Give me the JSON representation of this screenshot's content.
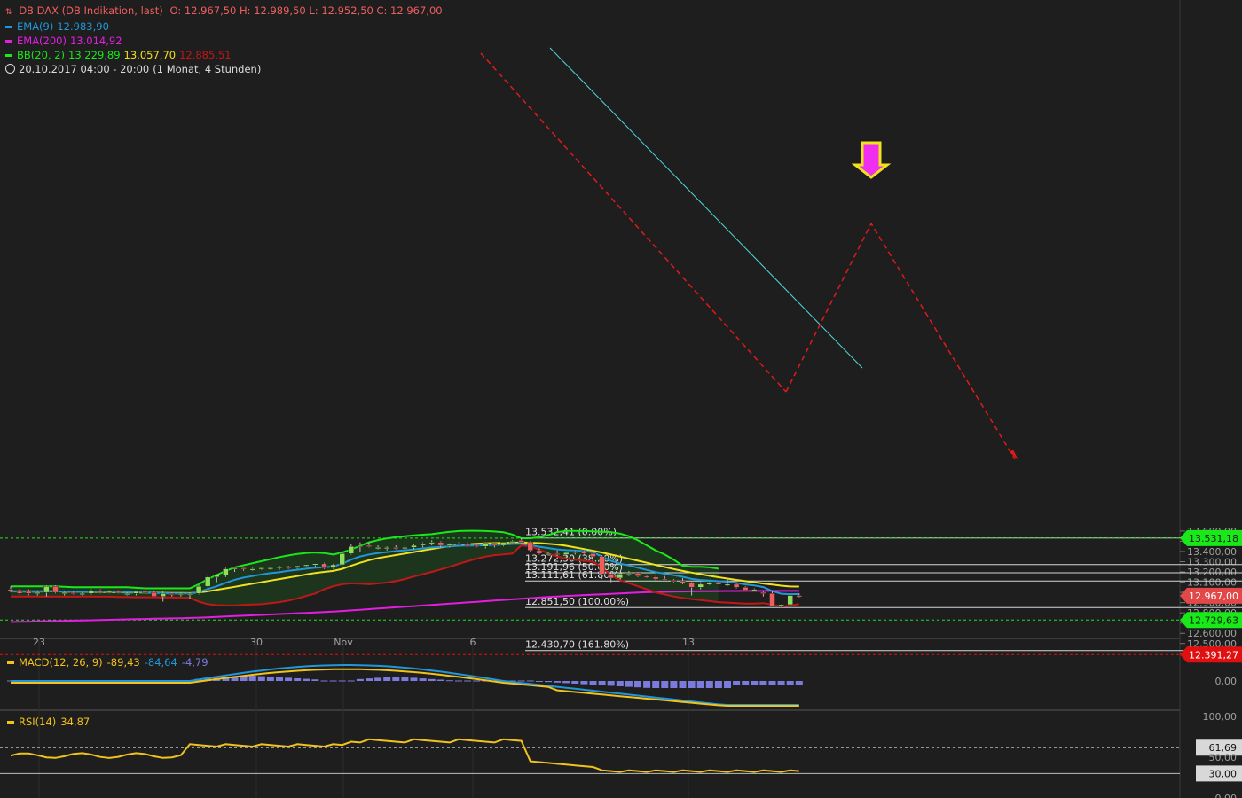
{
  "header": {
    "title": "DB DAX (DB Indikation, last)",
    "ohlc": "O: 12.967,50   H: 12.989,50   L: 12.952,50   C: 12.967,00",
    "ema9_label": "EMA(9)",
    "ema9_value": "12.983,90",
    "ema200_label": "EMA(200)",
    "ema200_value": "13.014,92",
    "bb_label": "BB(20, 2)",
    "bb_upper": "13.229,89",
    "bb_mid": "13.057,70",
    "bb_lower": "12.885,51",
    "period": "20.10.2017 04:00 - 20:00",
    "interval": "(1 Monat, 4 Stunden)"
  },
  "macd_legend": {
    "label": "MACD(12, 26, 9)",
    "v1": "-89,43",
    "v2": "-84,64",
    "v3": "-4,79"
  },
  "rsi_legend": {
    "label": "RSI(14)",
    "value": "34,87"
  },
  "colors": {
    "background": "#1e1e1e",
    "bull": "#8ee05a",
    "bear": "#ef5e5e",
    "ema9": "#2196d8",
    "ema200": "#e21ee0",
    "bb_band": "#19e819",
    "bb_mid": "#f2e21c",
    "bb_lower": "#c01818",
    "fill": "#1d3a1d",
    "grid": "#383838",
    "axis_text": "#a0a0a0"
  },
  "chart_data": {
    "type": "candlestick",
    "instrument": "DB DAX (DB Indikation, last)",
    "x_ticks": [
      "23",
      "30",
      "Nov",
      "6",
      "13"
    ],
    "y_ticks": [
      "13.600,00",
      "13.500,00",
      "13.400,00",
      "13.300,00",
      "13.200,00",
      "13.100,00",
      "13.000,00",
      "12.900,00",
      "12.800,00",
      "12.700,00",
      "12.600,00",
      "12.500,00",
      "12.400,00"
    ],
    "ylim": [
      12380,
      13610
    ],
    "markers": [
      {
        "label": "13.531,18",
        "value": 13531.18,
        "color": "#19e819"
      },
      {
        "label": "12.967,00",
        "value": 12967.0,
        "color": "#e24848"
      },
      {
        "label": "12.729,63",
        "value": 12729.63,
        "color": "#19e819"
      },
      {
        "label": "12.391,27",
        "value": 12391.27,
        "color": "#e01010"
      }
    ],
    "fib_levels": [
      {
        "label": "13.532,41 (0.00%)",
        "value": 13532.41
      },
      {
        "label": "13.272,30 (38.20%)",
        "value": 13272.3
      },
      {
        "label": "13.191,96 (50.00%)",
        "value": 13191.96
      },
      {
        "label": "13.111,61 (61.80%)",
        "value": 13111.61
      },
      {
        "label": "12.851,50 (100.00%)",
        "value": 12851.5
      },
      {
        "label": "12.430,70 (161.80%)",
        "value": 12430.7
      }
    ],
    "candles": [
      [
        13030,
        13060,
        13000,
        13010
      ],
      [
        13010,
        13030,
        12980,
        12990
      ],
      [
        13010,
        13030,
        12970,
        12990
      ],
      [
        12990,
        13020,
        12970,
        13000
      ],
      [
        13000,
        13070,
        12960,
        13060
      ],
      [
        13060,
        13070,
        12990,
        13000
      ],
      [
        12990,
        13010,
        12970,
        13000
      ],
      [
        13000,
        13010,
        12980,
        12990
      ],
      [
        12980,
        13000,
        12970,
        12990
      ],
      [
        12990,
        13030,
        12980,
        13020
      ],
      [
        13020,
        13030,
        12990,
        13000
      ],
      [
        13010,
        13020,
        12990,
        13010
      ],
      [
        13010,
        13020,
        12990,
        13000
      ],
      [
        12990,
        13000,
        12970,
        12990
      ],
      [
        12990,
        13000,
        12970,
        13010
      ],
      [
        13010,
        13020,
        12990,
        13000
      ],
      [
        13000,
        13010,
        12960,
        12960
      ],
      [
        12960,
        13010,
        12910,
        12990
      ],
      [
        12990,
        13000,
        12960,
        12980
      ],
      [
        12980,
        13000,
        12960,
        12990
      ],
      [
        12990,
        13000,
        12940,
        12990
      ],
      [
        12990,
        13070,
        12980,
        13060
      ],
      [
        13060,
        13160,
        13050,
        13150
      ],
      [
        13150,
        13170,
        13100,
        13170
      ],
      [
        13170,
        13240,
        13150,
        13230
      ],
      [
        13230,
        13250,
        13200,
        13240
      ],
      [
        13240,
        13250,
        13210,
        13230
      ],
      [
        13220,
        13240,
        13210,
        13230
      ],
      [
        13230,
        13240,
        13220,
        13240
      ],
      [
        13230,
        13250,
        13220,
        13240
      ],
      [
        13240,
        13260,
        13220,
        13250
      ],
      [
        13250,
        13260,
        13230,
        13240
      ],
      [
        13240,
        13250,
        13230,
        13260
      ],
      [
        13260,
        13270,
        13250,
        13270
      ],
      [
        13270,
        13280,
        13250,
        13280
      ],
      [
        13280,
        13290,
        13230,
        13240
      ],
      [
        13240,
        13280,
        13230,
        13270
      ],
      [
        13270,
        13380,
        13260,
        13380
      ],
      [
        13380,
        13470,
        13370,
        13450
      ],
      [
        13450,
        13490,
        13400,
        13460
      ],
      [
        13460,
        13490,
        13440,
        13450
      ],
      [
        13440,
        13460,
        13420,
        13440
      ],
      [
        13430,
        13450,
        13410,
        13440
      ],
      [
        13440,
        13460,
        13420,
        13430
      ],
      [
        13430,
        13460,
        13400,
        13440
      ],
      [
        13440,
        13470,
        13420,
        13460
      ],
      [
        13460,
        13490,
        13440,
        13480
      ],
      [
        13480,
        13510,
        13460,
        13490
      ],
      [
        13490,
        13500,
        13440,
        13460
      ],
      [
        13460,
        13480,
        13440,
        13470
      ],
      [
        13470,
        13490,
        13460,
        13480
      ],
      [
        13480,
        13490,
        13450,
        13460
      ],
      [
        13460,
        13480,
        13440,
        13450
      ],
      [
        13450,
        13490,
        13430,
        13480
      ],
      [
        13480,
        13490,
        13440,
        13460
      ],
      [
        13460,
        13490,
        13450,
        13490
      ],
      [
        13490,
        13510,
        13480,
        13500
      ],
      [
        13510,
        13530,
        13480,
        13490
      ],
      [
        13490,
        13500,
        13400,
        13410
      ],
      [
        13410,
        13430,
        13370,
        13380
      ],
      [
        13380,
        13400,
        13370,
        13380
      ],
      [
        13380,
        13410,
        13360,
        13370
      ],
      [
        13370,
        13400,
        13350,
        13390
      ],
      [
        13390,
        13410,
        13370,
        13400
      ],
      [
        13400,
        13410,
        13370,
        13380
      ],
      [
        13380,
        13400,
        13330,
        13350
      ],
      [
        13350,
        13360,
        13130,
        13180
      ],
      [
        13180,
        13200,
        13100,
        13140
      ],
      [
        13140,
        13190,
        13130,
        13180
      ],
      [
        13180,
        13210,
        13160,
        13190
      ],
      [
        13190,
        13200,
        13150,
        13160
      ],
      [
        13160,
        13170,
        13140,
        13150
      ],
      [
        13150,
        13160,
        13110,
        13130
      ],
      [
        13130,
        13160,
        13110,
        13120
      ],
      [
        13120,
        13130,
        13100,
        13110
      ],
      [
        13110,
        13140,
        13080,
        13090
      ],
      [
        13090,
        13100,
        12970,
        13050
      ],
      [
        13050,
        13100,
        13030,
        13080
      ],
      [
        13080,
        13100,
        13070,
        13090
      ],
      [
        13090,
        13100,
        13080,
        13080
      ],
      [
        13080,
        13140,
        13060,
        13080
      ],
      [
        13080,
        13090,
        13040,
        13050
      ],
      [
        13050,
        13060,
        13010,
        13020
      ],
      [
        13020,
        13040,
        13010,
        13030
      ],
      [
        13000,
        13010,
        12960,
        12990
      ],
      [
        12990,
        13010,
        12860,
        12860
      ],
      [
        12860,
        12870,
        12850,
        12880
      ],
      [
        12880,
        12970,
        12870,
        12970
      ],
      [
        12970,
        12990,
        12950,
        12967
      ]
    ],
    "ema9": [
      13010,
      13008,
      13006,
      13004,
      13012,
      13010,
      13009,
      13007,
      13004,
      13007,
      13006,
      13006,
      13005,
      13001,
      13003,
      13003,
      12994,
      12993,
      12990,
      12990,
      12990,
      13004,
      13033,
      13060,
      13094,
      13123,
      13145,
      13160,
      13176,
      13188,
      13197,
      13211,
      13221,
      13232,
      13242,
      13245,
      13254,
      13280,
      13320,
      13351,
      13371,
      13384,
      13395,
      13404,
      13412,
      13420,
      13430,
      13440,
      13445,
      13450,
      13456,
      13458,
      13458,
      13461,
      13462,
      13468,
      13474,
      13477,
      13464,
      13447,
      13434,
      13421,
      13414,
      13409,
      13404,
      13393,
      13350,
      13308,
      13282,
      13263,
      13241,
      13219,
      13198,
      13183,
      13168,
      13153,
      13132,
      13121,
      13115,
      13109,
      13104,
      13093,
      13078,
      13068,
      13052,
      13013,
      12987,
      12983,
      12984
    ],
    "ema200": [
      12710,
      12712,
      12714,
      12716,
      12718,
      12720,
      12722,
      12724,
      12726,
      12728,
      12730,
      12732,
      12734,
      12736,
      12738,
      12740,
      12742,
      12744,
      12746,
      12748,
      12750,
      12753,
      12756,
      12760,
      12764,
      12768,
      12772,
      12776,
      12780,
      12784,
      12788,
      12792,
      12796,
      12800,
      12804,
      12808,
      12813,
      12818,
      12824,
      12830,
      12836,
      12842,
      12848,
      12854,
      12860,
      12866,
      12872,
      12878,
      12884,
      12890,
      12896,
      12902,
      12908,
      12914,
      12920,
      12926,
      12932,
      12938,
      12944,
      12950,
      12955,
      12960,
      12965,
      12970,
      12974,
      12978,
      12982,
      12986,
      12990,
      12994,
      12998,
      13002,
      13004,
      13006,
      13008,
      13009,
      13010,
      13011,
      13012,
      13013,
      13014,
      13014,
      13015,
      13015,
      13015,
      13015,
      13015,
      13015,
      13015
    ],
    "bb_upper": [
      13060,
      13060,
      13060,
      13060,
      13060,
      13060,
      13055,
      13050,
      13050,
      13050,
      13050,
      13050,
      13050,
      13050,
      13045,
      13040,
      13040,
      13040,
      13040,
      13040,
      13040,
      13080,
      13130,
      13170,
      13210,
      13245,
      13265,
      13285,
      13305,
      13325,
      13345,
      13362,
      13376,
      13386,
      13390,
      13385,
      13370,
      13390,
      13420,
      13455,
      13490,
      13512,
      13528,
      13540,
      13550,
      13558,
      13565,
      13570,
      13582,
      13592,
      13600,
      13603,
      13603,
      13600,
      13596,
      13588,
      13566,
      13530,
      13530,
      13540,
      13560,
      13590,
      13602,
      13602,
      13600,
      13597,
      13593,
      13590,
      13576,
      13550,
      13510,
      13460,
      13410,
      13370,
      13320,
      13260,
      13250,
      13250,
      13245,
      13232
    ],
    "bb_mid": [
      13010,
      13010,
      13010,
      13010,
      13010,
      13010,
      13008,
      13006,
      13005,
      13004,
      13003,
      13002,
      13001,
      13000,
      12999,
      12998,
      12997,
      12996,
      12995,
      12994,
      12993,
      12998,
      13010,
      13025,
      13040,
      13055,
      13070,
      13085,
      13100,
      13115,
      13130,
      13145,
      13160,
      13175,
      13190,
      13200,
      13210,
      13230,
      13260,
      13290,
      13315,
      13335,
      13350,
      13365,
      13380,
      13395,
      13410,
      13425,
      13440,
      13452,
      13463,
      13470,
      13475,
      13480,
      13482,
      13484,
      13486,
      13488,
      13486,
      13482,
      13476,
      13468,
      13456,
      13440,
      13424,
      13408,
      13390,
      13370,
      13350,
      13330,
      13310,
      13290,
      13268,
      13248,
      13228,
      13210,
      13193,
      13178,
      13162,
      13148,
      13135,
      13122,
      13110,
      13098,
      13087,
      13076,
      13066,
      13058,
      13057
    ],
    "bb_lower": [
      12960,
      12960,
      12960,
      12960,
      12960,
      12960,
      12958,
      12958,
      12960,
      12960,
      12958,
      12958,
      12956,
      12954,
      12952,
      12952,
      12952,
      12950,
      12950,
      12948,
      12947,
      12910,
      12885,
      12875,
      12872,
      12872,
      12878,
      12882,
      12885,
      12895,
      12905,
      12920,
      12940,
      12965,
      12990,
      13030,
      13060,
      13080,
      13090,
      13085,
      13080,
      13088,
      13096,
      13110,
      13130,
      13155,
      13178,
      13200,
      13225,
      13250,
      13278,
      13305,
      13330,
      13350,
      13364,
      13372,
      13380,
      13460,
      13450,
      13420,
      13380,
      13350,
      13330,
      13318,
      13310,
      13300,
      13240,
      13165,
      13120,
      13090,
      13060,
      13030,
      13000,
      12980,
      12960,
      12945,
      12935,
      12925,
      12915,
      12905,
      12900,
      12895,
      12890,
      12890,
      12895,
      12880,
      12860,
      12870,
      12886
    ],
    "macd_label": "MACD(12, 26, 9)",
    "rsi_label": "RSI(14)",
    "rsi_ticks": [
      "100,00",
      "61,69",
      "50,00",
      "30,00",
      "0,00"
    ],
    "macd_ticks": [
      "0,00"
    ],
    "rsi_markers": [
      "61,69",
      "30,00"
    ]
  }
}
